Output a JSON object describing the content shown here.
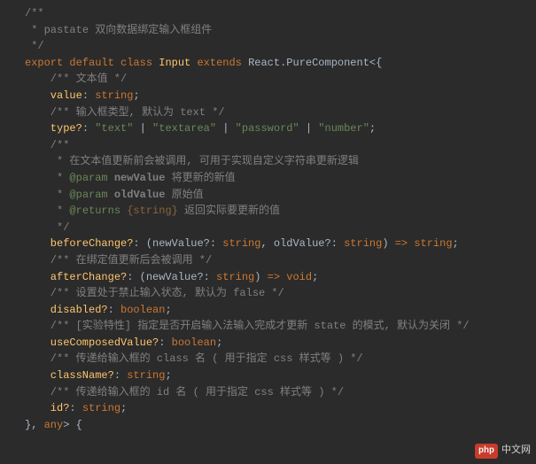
{
  "code": {
    "l1": "/**",
    "l2a": " * ",
    "l2b": "pastate 双向数据绑定输入框组件",
    "l3": " */",
    "l4_export": "export ",
    "l4_default": "default ",
    "l4_class": "class ",
    "l4_Input": "Input ",
    "l4_extends": "extends ",
    "l4_React": "React.PureComponent",
    "l4_tail": "<{",
    "l5": "    /** 文本值 */",
    "l6_name": "    value",
    "l6_punc": ": ",
    "l6_type": "string",
    "l6_semi": ";",
    "l7": "    /** 输入框类型, 默认为 text */",
    "l8_name": "    type?",
    "l8_punc": ": ",
    "l8_s1": "\"text\"",
    "l8_bar1": " | ",
    "l8_s2": "\"textarea\"",
    "l8_bar2": " | ",
    "l8_s3": "\"password\"",
    "l8_bar3": " | ",
    "l8_s4": "\"number\"",
    "l8_semi": ";",
    "l9": "    /**",
    "l10a": "     * ",
    "l10b": "在文本值更新前会被调用, 可用于实现自定义字符串更新逻辑",
    "l11a": "     * ",
    "l11tag": "@param",
    "l11name": " newValue",
    "l11desc": " 将更新的新值",
    "l12a": "     * ",
    "l12tag": "@param",
    "l12name": " oldValue",
    "l12desc": " 原始值",
    "l13a": "     * ",
    "l13tag": "@returns",
    "l13type": " {string}",
    "l13desc": " 返回实际要更新的值",
    "l14": "     */",
    "l15_name": "    beforeChange?",
    "l15_c1": ": (",
    "l15_p1": "newValue?",
    "l15_c2": ": ",
    "l15_t1": "string",
    "l15_c3": ", ",
    "l15_p2": "oldValue?",
    "l15_c4": ": ",
    "l15_t2": "string",
    "l15_c5": ") ",
    "l15_arrow": "=>",
    "l15_c6": " ",
    "l15_ret": "string",
    "l15_semi": ";",
    "l16": "    /** 在绑定值更新后会被调用 */",
    "l17_name": "    afterChange?",
    "l17_c1": ": (",
    "l17_p1": "newValue?",
    "l17_c2": ": ",
    "l17_t1": "string",
    "l17_c3": ") ",
    "l17_arrow": "=>",
    "l17_c4": " ",
    "l17_ret": "void",
    "l17_semi": ";",
    "l18": "    /** 设置处于禁止输入状态, 默认为 false */",
    "l19_name": "    disabled?",
    "l19_c1": ": ",
    "l19_type": "boolean",
    "l19_semi": ";",
    "l20": "    /** [实验特性] 指定是否开启输入法输入完成才更新 state 的模式, 默认为关闭 */",
    "l21_name": "    useComposedValue?",
    "l21_c1": ": ",
    "l21_type": "boolean",
    "l21_semi": ";",
    "l22": "    /** 传递给输入框的 class 名 ( 用于指定 css 样式等 ) */",
    "l23_name": "    className?",
    "l23_c1": ": ",
    "l23_type": "string",
    "l23_semi": ";",
    "l24": "    /** 传递给输入框的 id 名 ( 用于指定 css 样式等 ) */",
    "l25_name": "    id?",
    "l25_c1": ": ",
    "l25_type": "string",
    "l25_semi": ";",
    "l26_a": "}, ",
    "l26_b": "any",
    "l26_c": "> {"
  },
  "watermark": {
    "logo": "php",
    "text": "中文网"
  }
}
